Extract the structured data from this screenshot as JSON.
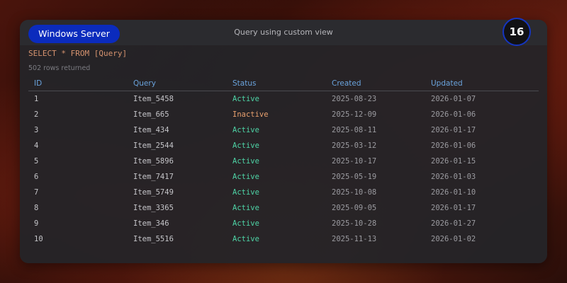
{
  "header": {
    "server_label": "Windows Server",
    "subtitle": "Query using custom view",
    "count_badge": "16"
  },
  "query": {
    "sql": "SELECT * FROM [Query]",
    "rows_returned": "502 rows returned"
  },
  "table": {
    "columns": [
      "ID",
      "Query",
      "Status",
      "Created",
      "Updated"
    ],
    "rows": [
      {
        "id": "1",
        "query": "Item_5458",
        "status": "Active",
        "created": "2025-08-23",
        "updated": "2026-01-07"
      },
      {
        "id": "2",
        "query": "Item_665",
        "status": "Inactive",
        "created": "2025-12-09",
        "updated": "2026-01-06"
      },
      {
        "id": "3",
        "query": "Item_434",
        "status": "Active",
        "created": "2025-08-11",
        "updated": "2026-01-17"
      },
      {
        "id": "4",
        "query": "Item_2544",
        "status": "Active",
        "created": "2025-03-12",
        "updated": "2026-01-06"
      },
      {
        "id": "5",
        "query": "Item_5896",
        "status": "Active",
        "created": "2025-10-17",
        "updated": "2026-01-15"
      },
      {
        "id": "6",
        "query": "Item_7417",
        "status": "Active",
        "created": "2025-05-19",
        "updated": "2026-01-03"
      },
      {
        "id": "7",
        "query": "Item_5749",
        "status": "Active",
        "created": "2025-10-08",
        "updated": "2026-01-10"
      },
      {
        "id": "8",
        "query": "Item_3365",
        "status": "Active",
        "created": "2025-09-05",
        "updated": "2026-01-17"
      },
      {
        "id": "9",
        "query": "Item_346",
        "status": "Active",
        "created": "2025-10-28",
        "updated": "2026-01-27"
      },
      {
        "id": "10",
        "query": "Item_5516",
        "status": "Active",
        "created": "2025-11-13",
        "updated": "2026-01-02"
      }
    ]
  },
  "colors": {
    "accent": "#0b2bbd",
    "header_text": "#6aa3dc",
    "status_active": "#4ed4a6",
    "status_inactive": "#e8a06e",
    "sql_text": "#d6936f"
  }
}
